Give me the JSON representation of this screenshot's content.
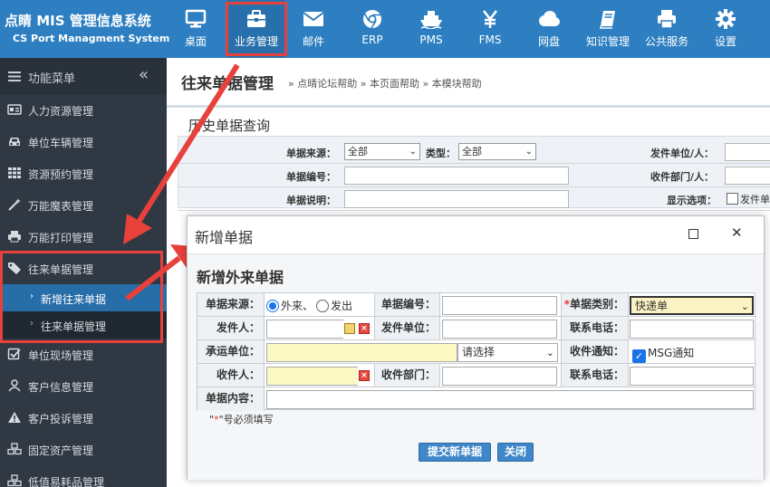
{
  "brand": {
    "title": "点睛 MIS 管理信息系统",
    "subtitle": "CS Port Managment System"
  },
  "nav": [
    {
      "label": "桌面",
      "icon": "desktop-icon"
    },
    {
      "label": "业务管理",
      "icon": "briefcase-icon"
    },
    {
      "label": "邮件",
      "icon": "mail-icon"
    },
    {
      "label": "ERP",
      "icon": "chrome-icon"
    },
    {
      "label": "PMS",
      "icon": "ship-icon"
    },
    {
      "label": "FMS",
      "icon": "yen-icon"
    },
    {
      "label": "网盘",
      "icon": "cloud-icon"
    },
    {
      "label": "知识管理",
      "icon": "book-icon"
    },
    {
      "label": "公共服务",
      "icon": "printer-icon"
    },
    {
      "label": "设置",
      "icon": "gear-icon"
    }
  ],
  "sidebar": {
    "header": "功能菜单",
    "collapse": "«",
    "items": [
      {
        "label": "人力资源管理",
        "icon": "id-card-icon"
      },
      {
        "label": "单位车辆管理",
        "icon": "car-icon"
      },
      {
        "label": "资源预约管理",
        "icon": "grid-icon"
      },
      {
        "label": "万能魔表管理",
        "icon": "magic-wand-icon"
      },
      {
        "label": "万能打印管理",
        "icon": "printer-icon"
      },
      {
        "label": "往来单据管理",
        "icon": "tag-icon"
      },
      {
        "label": "单位现场管理",
        "icon": "check-square-icon"
      },
      {
        "label": "客户信息管理",
        "icon": "user-icon"
      },
      {
        "label": "客户投诉管理",
        "icon": "warning-icon"
      },
      {
        "label": "固定资产管理",
        "icon": "cubes-icon"
      },
      {
        "label": "低值易耗品管理",
        "icon": "cubes-icon"
      }
    ],
    "subitems": [
      {
        "label": "新增往来单据",
        "active": true
      },
      {
        "label": "往来单据管理",
        "active": false
      }
    ]
  },
  "content": {
    "title": "往来单据管理",
    "links": "» 点晴论坛帮助 » 本页面帮助 » 本模块帮助",
    "history_title": "历史单据查询",
    "filters": {
      "source_label": "单据来源：",
      "source_value": "全部",
      "type_label": "类型：",
      "type_value": "全部",
      "number_label": "单据编号：",
      "desc_label": "单据说明：",
      "sender_label": "发件单位/人：",
      "dept_label": "收件部门/人：",
      "display_label": "显示选项：",
      "display_option": "发件单"
    }
  },
  "modal": {
    "title": "新增单据",
    "subtitle": "新增外来单据",
    "source_label": "单据来源：",
    "source_options": [
      "外来、",
      "发出"
    ],
    "number_label": "单据编号：",
    "type_label": "单据类别：",
    "type_required": "*",
    "type_value": "快递单",
    "sender_label": "发件人：",
    "sender_unit_label": "发件单位：",
    "phone_label": "联系电话：",
    "carrier_label": "承运单位：",
    "carrier_select": "请选择",
    "notify_label": "收件通知：",
    "notify_option": "MSG通知",
    "receiver_label": "收件人：",
    "receiver_dept_label": "收件部门：",
    "phone2_label": "联系电话：",
    "content_label": "单据内容：",
    "note_prefix": "\"",
    "note_star": "*",
    "note_suffix": "\"号必须填写",
    "submit": "提交新单据",
    "close": "关闭"
  }
}
